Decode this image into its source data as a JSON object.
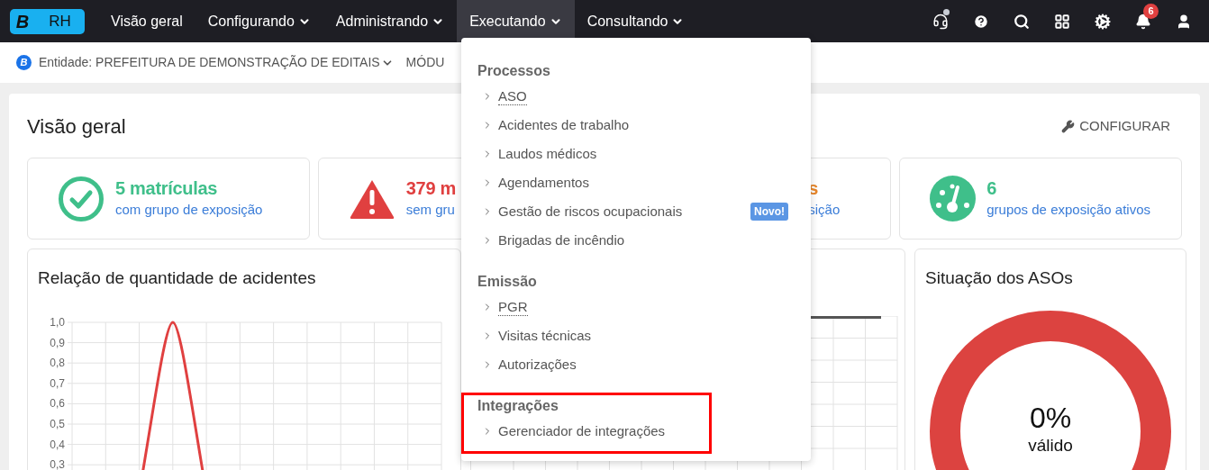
{
  "logo": {
    "mark": "B",
    "text": "RH"
  },
  "nav": [
    {
      "label": "Visão geral",
      "dropdown": false,
      "selected": false
    },
    {
      "label": "Configurando",
      "dropdown": true,
      "selected": false
    },
    {
      "label": "Administrando",
      "dropdown": true,
      "selected": false
    },
    {
      "label": "Executando",
      "dropdown": true,
      "selected": true
    },
    {
      "label": "Consultando",
      "dropdown": true,
      "selected": false
    }
  ],
  "toolbar": [
    {
      "kind": "headset"
    },
    {
      "kind": "help"
    },
    {
      "kind": "search"
    },
    {
      "kind": "grid"
    },
    {
      "kind": "cogs"
    },
    {
      "kind": "bell",
      "badge": "6"
    },
    {
      "kind": "user"
    }
  ],
  "context_bar": {
    "logo_mark": "B",
    "entity": "Entidade: PREFEITURA DE DEMONSTRAÇÃO DE EDITAIS",
    "module": "MÓDU"
  },
  "page": {
    "title": "Visão geral",
    "action": "CONFIGURAR"
  },
  "stats": [
    {
      "kind": "check",
      "value": "5 matrículas",
      "label": "com grupo de exposição",
      "color": "#3fbf8a"
    },
    {
      "kind": "warning",
      "value": "379 m",
      "label": "sem gru",
      "color": "#e04040"
    },
    {
      "kind": "covered",
      "value": "s",
      "label": "sição",
      "color": "#e8862a"
    },
    {
      "kind": "gauge",
      "value": "6",
      "label": "grupos de exposição ativos",
      "color": "#3fbf8a"
    }
  ],
  "accidents_chart": {
    "title": "Relação de quantidade de acidentes",
    "y_axis_labels": [
      "1,0",
      "0,9",
      "0,8",
      "0,7",
      "0,6",
      "0,5",
      "0,4",
      "0,3"
    ]
  },
  "aso_status": {
    "title": "Situação dos ASOs",
    "percent": "0%",
    "caption": "válido"
  },
  "menu": [
    {
      "title": "Processos",
      "highlighted": false,
      "items": [
        {
          "label": "ASO",
          "kind": "abbr"
        },
        {
          "label": "Acidentes de trabalho",
          "kind": "link"
        },
        {
          "label": "Laudos médicos",
          "kind": "link"
        },
        {
          "label": "Agendamentos",
          "kind": "link"
        },
        {
          "label": "Gestão de riscos ocupacionais",
          "kind": "link",
          "badge": "Novo!"
        },
        {
          "label": "Brigadas de incêndio",
          "kind": "link"
        }
      ]
    },
    {
      "title": "Emissão",
      "highlighted": false,
      "items": [
        {
          "label": "PGR",
          "kind": "abbr"
        },
        {
          "label": "Visitas técnicas",
          "kind": "link"
        },
        {
          "label": "Autorizações",
          "kind": "link"
        }
      ]
    },
    {
      "title": "Integrações",
      "highlighted": true,
      "items": [
        {
          "label": "Gerenciador de integrações",
          "kind": "link"
        }
      ]
    }
  ]
}
